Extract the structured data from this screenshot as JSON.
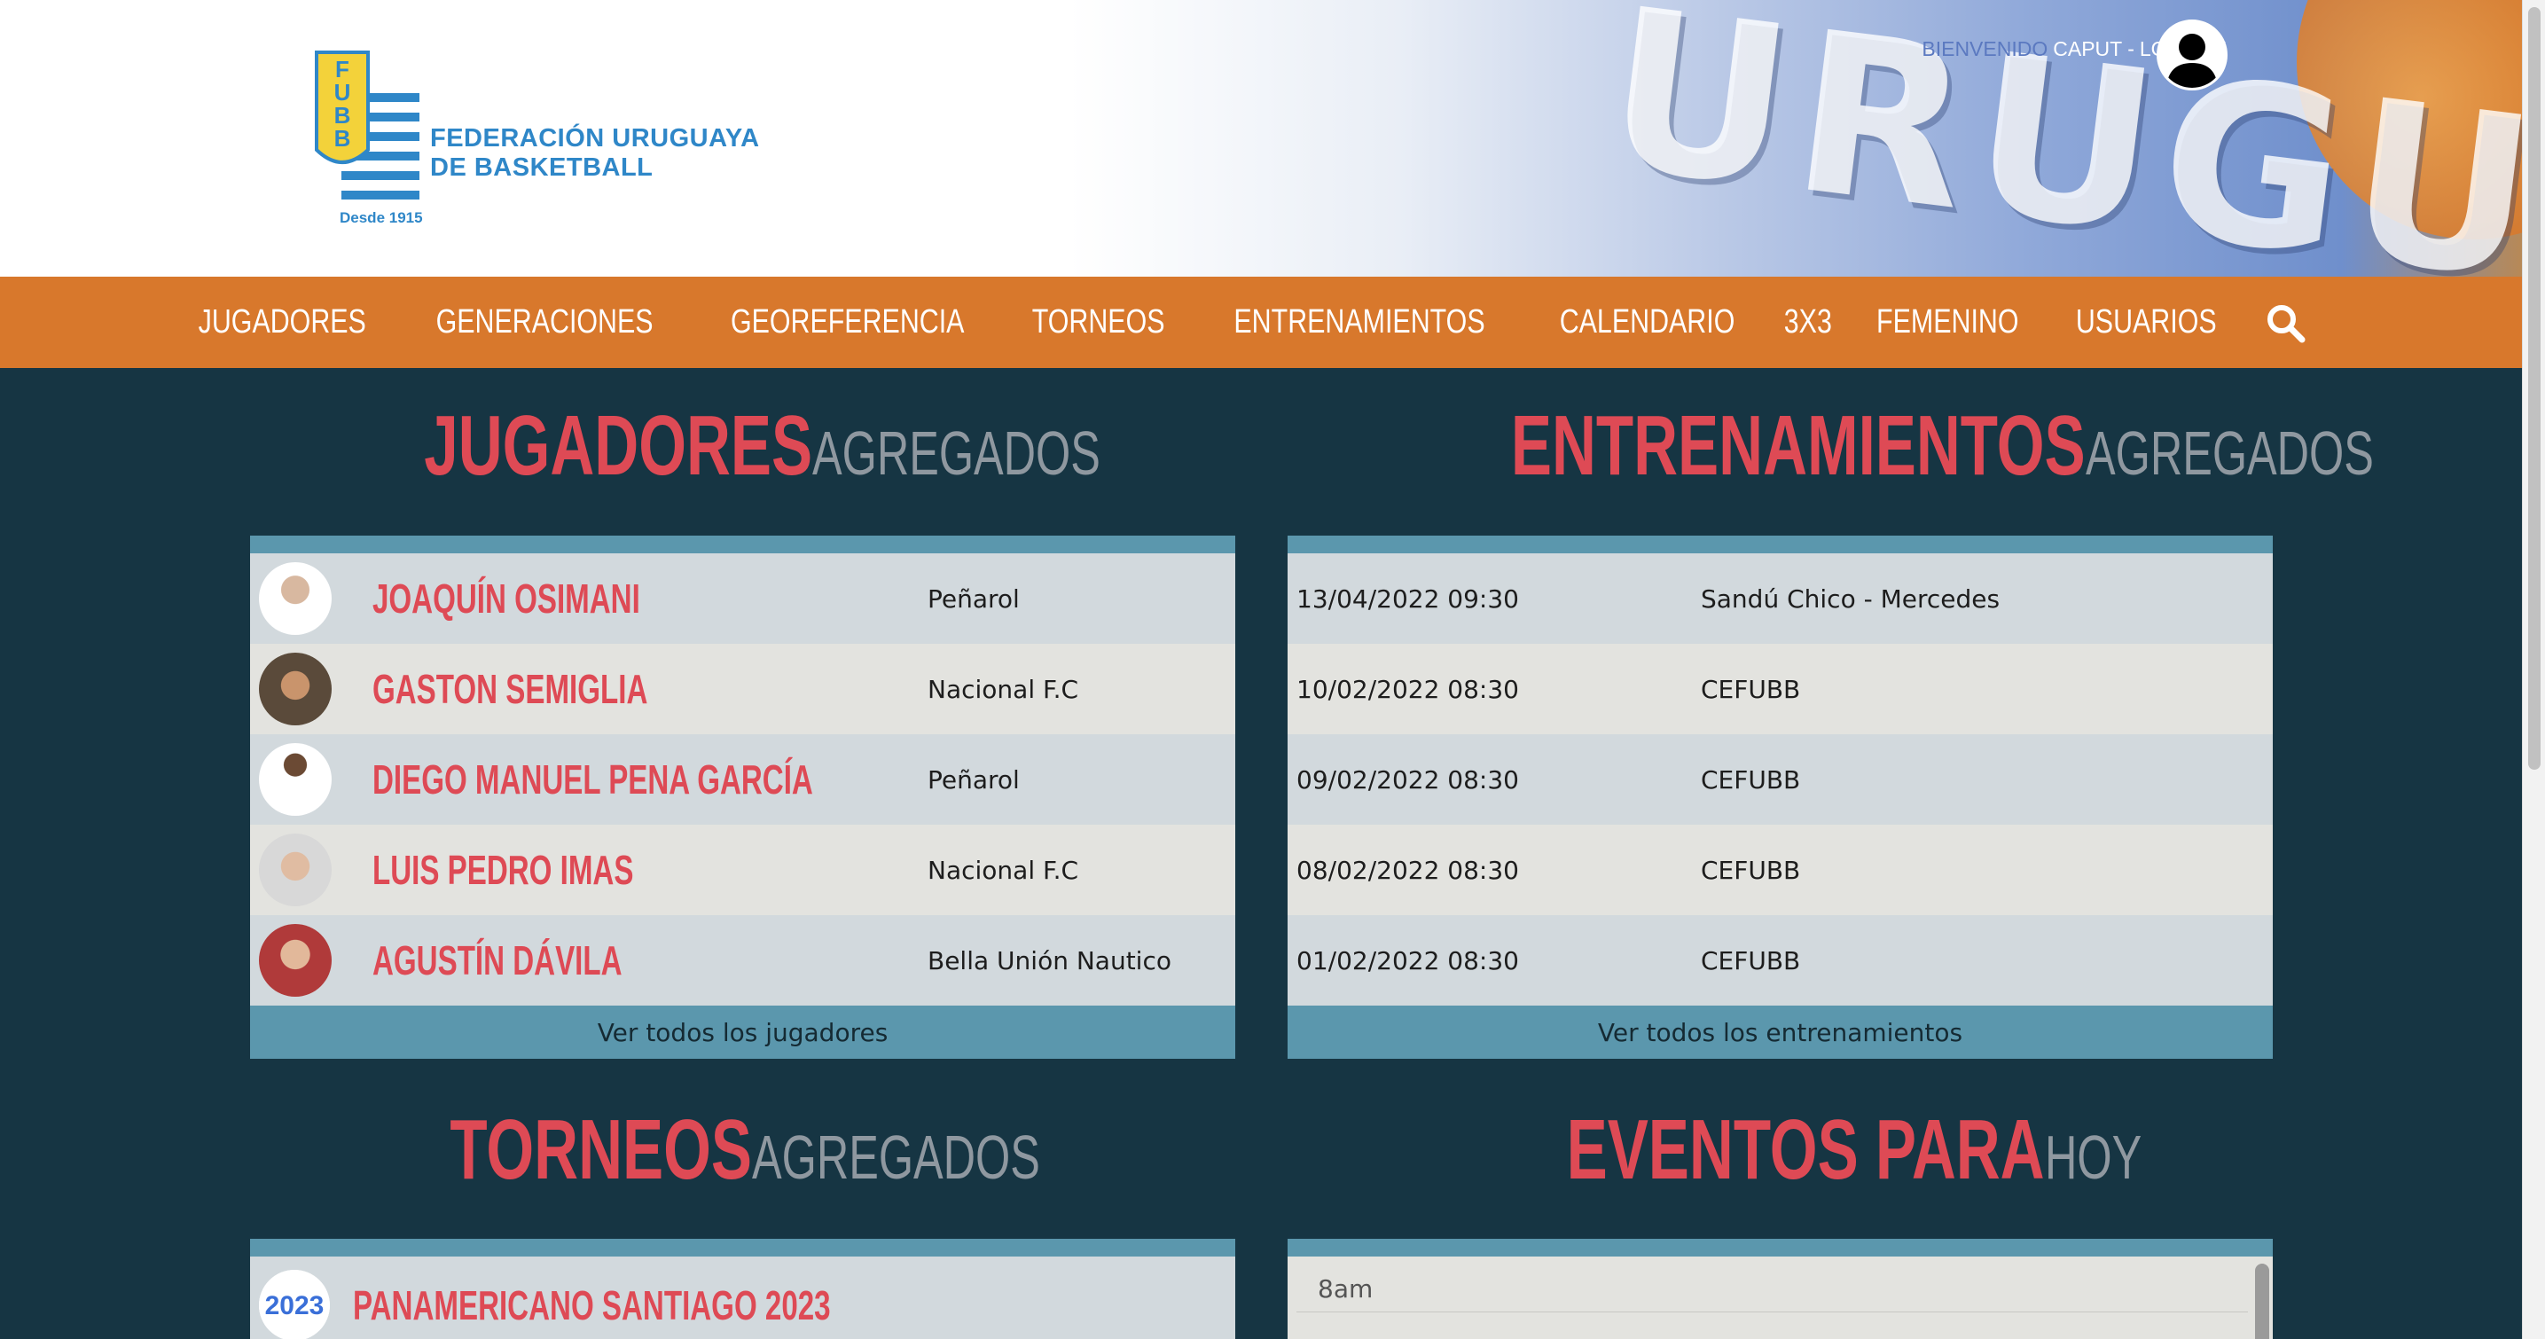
{
  "header": {
    "logo_letters": "FUBB",
    "org_name_line1": "FEDERACIÓN URUGUAYA",
    "org_name_line2": "DE BASKETBALL",
    "since": "Desde 1915",
    "banner_text": "URUGUAY",
    "welcome": "BIENVENIDO",
    "username": "CAPUT",
    "separator": "-",
    "logout": "LOGOUT"
  },
  "nav": {
    "items": [
      "JUGADORES",
      "GENERACIONES",
      "GEOREFERENCIA",
      "TORNEOS",
      "ENTRENAMIENTOS",
      "CALENDARIO",
      "3X3",
      "FEMENINO",
      "USUARIOS"
    ],
    "search_icon": "search-icon"
  },
  "players_section": {
    "title_bold": "JUGADORES",
    "title_light": "AGREGADOS",
    "rows": [
      {
        "name": "JOAQUÍN OSIMANI",
        "club": "Peñarol"
      },
      {
        "name": "GASTON SEMIGLIA",
        "club": "Nacional F.C"
      },
      {
        "name": "DIEGO MANUEL PENA GARCÍA",
        "club": "Peñarol"
      },
      {
        "name": "LUIS PEDRO IMAS",
        "club": "Nacional F.C"
      },
      {
        "name": "AGUSTÍN DÁVILA",
        "club": "Bella Unión Nautico"
      }
    ],
    "footer": "Ver todos los jugadores"
  },
  "trainings_section": {
    "title_bold": "ENTRENAMIENTOS",
    "title_light": "AGREGADOS",
    "rows": [
      {
        "date": "13/04/2022 09:30",
        "place": "Sandú Chico - Mercedes"
      },
      {
        "date": "10/02/2022 08:30",
        "place": "CEFUBB"
      },
      {
        "date": "09/02/2022 08:30",
        "place": "CEFUBB"
      },
      {
        "date": "08/02/2022 08:30",
        "place": "CEFUBB"
      },
      {
        "date": "01/02/2022 08:30",
        "place": "CEFUBB"
      }
    ],
    "footer": "Ver todos los entrenamientos"
  },
  "tournaments_section": {
    "title_bold": "TORNEOS",
    "title_light": "AGREGADOS",
    "rows": [
      {
        "name": "PANAMERICANO SANTIAGO 2023",
        "logo_text": "2023"
      }
    ]
  },
  "events_section": {
    "title_bold": "EVENTOS PARA",
    "title_light": "HOY",
    "first_time": "8am"
  },
  "colors": {
    "background": "#163543",
    "nav": "#d8782c",
    "accent_red": "#de4a55",
    "panel_bar": "#5b97ad",
    "logo_blue": "#2f87c8",
    "logo_yellow": "#f3d23a"
  }
}
